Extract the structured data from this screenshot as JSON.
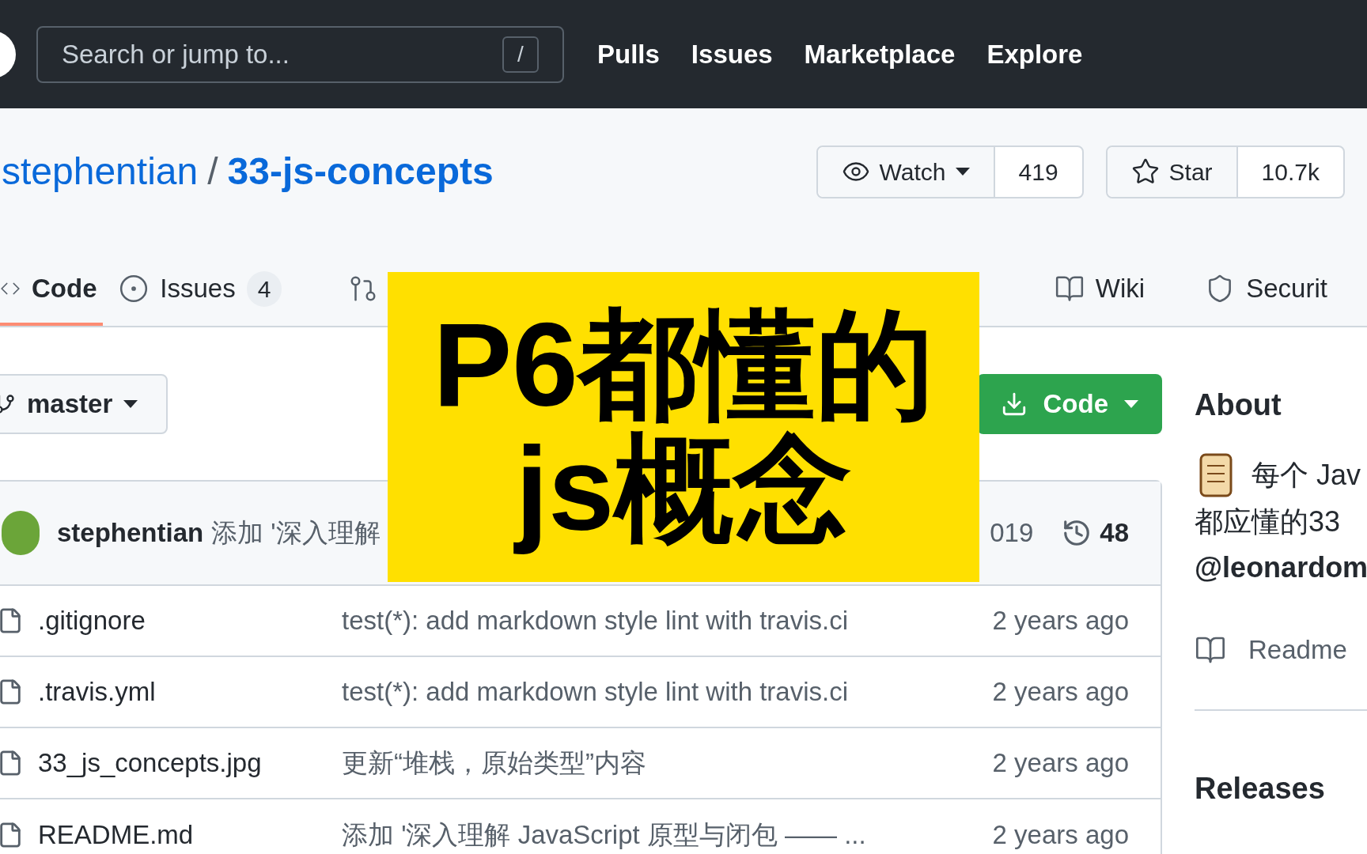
{
  "nav": {
    "search_placeholder": "Search or jump to...",
    "search_key": "/",
    "links": [
      "Pulls",
      "Issues",
      "Marketplace",
      "Explore"
    ]
  },
  "repo": {
    "owner": "stephentian",
    "separator": "/",
    "name": "33-js-concepts"
  },
  "actions": [
    {
      "kind": "watch",
      "label": "Watch",
      "count": "419"
    },
    {
      "kind": "star",
      "label": "Star",
      "count": "10.7k"
    }
  ],
  "tabs": [
    {
      "kind": "code",
      "label": "Code",
      "selected": true
    },
    {
      "kind": "issues",
      "label": "Issues",
      "count": "4",
      "selected": false
    },
    {
      "kind": "pulls",
      "selected": false
    },
    {
      "kind": "wiki",
      "label": "Wiki",
      "selected": false
    },
    {
      "kind": "security",
      "label": "Securit",
      "selected": false
    }
  ],
  "branch": {
    "label": "master"
  },
  "code_button": {
    "label": "Code"
  },
  "commit": {
    "author": "stephentian",
    "message": "添加 '深入理解",
    "date": "019",
    "count": "48"
  },
  "files": [
    {
      "name": ".gitignore",
      "message": "test(*): add markdown style lint with travis.ci",
      "age": "2 years ago"
    },
    {
      "name": ".travis.yml",
      "message": "test(*): add markdown style lint with travis.ci",
      "age": "2 years ago"
    },
    {
      "name": "33_js_concepts.jpg",
      "message": "更新“堆栈，原始类型”内容",
      "age": "2 years ago"
    },
    {
      "name": "README.md",
      "message": "添加 '深入理解 JavaScript 原型与闭包 —— ...",
      "age": "2 years ago"
    }
  ],
  "about": {
    "title": "About",
    "lines": [
      "每个 Jav",
      "都应懂的33",
      "@leonardom"
    ],
    "readme": "Readme",
    "releases": "Releases"
  },
  "banner": {
    "lines": [
      "P6都懂的",
      "js概念"
    ]
  }
}
